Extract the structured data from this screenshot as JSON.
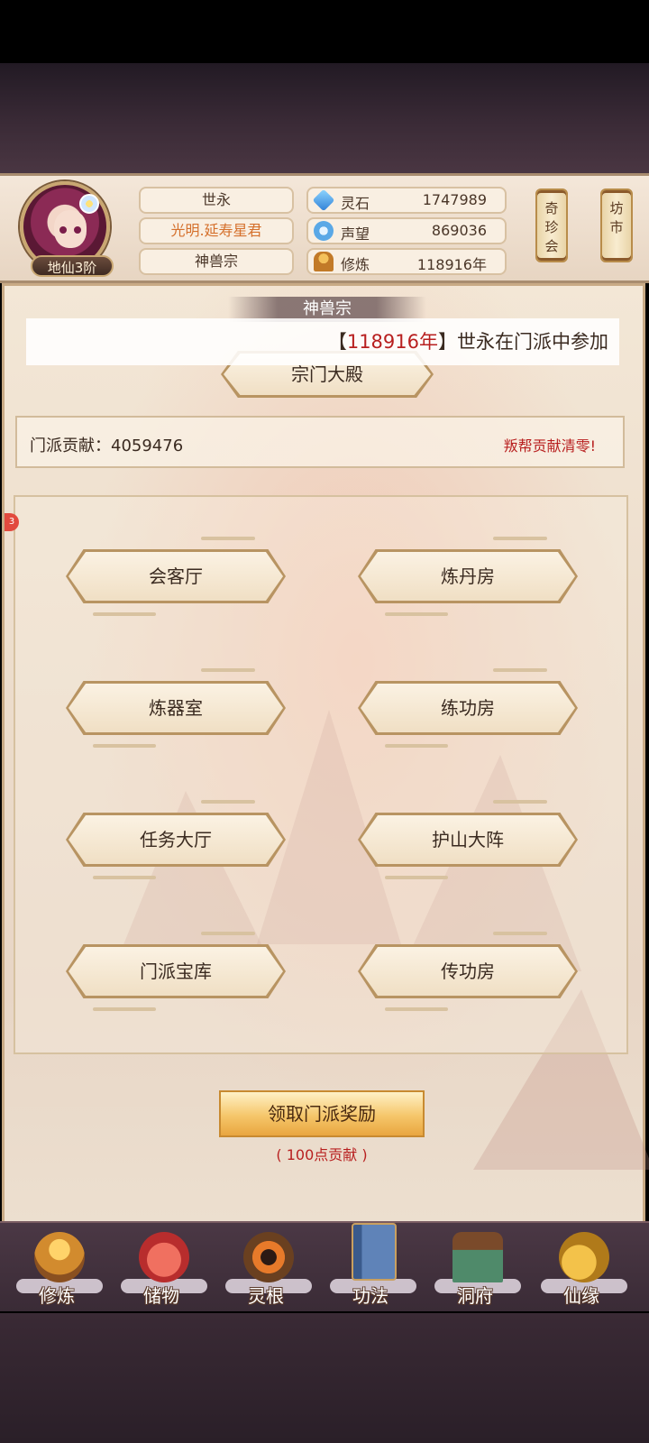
{
  "player": {
    "rank": "地仙3阶",
    "name": "世永",
    "title": "光明.延寿星君",
    "sect": "神兽宗"
  },
  "stats": [
    {
      "label": "灵石",
      "value": "1747989",
      "icon": "spirit-stone-icon"
    },
    {
      "label": "声望",
      "value": "869036",
      "icon": "reputation-icon"
    },
    {
      "label": "修炼",
      "value": "118916年",
      "icon": "cultivation-icon"
    }
  ],
  "side_buttons": {
    "treasure": "奇珍会",
    "market": "坊市"
  },
  "panel": {
    "sect_title": "神兽宗",
    "ticker": {
      "open": "【",
      "highlight": "118916年",
      "close": "】",
      "text": "世永在门派中参加"
    },
    "hall_button": "宗门大殿",
    "contribution_label": "门派贡献：",
    "contribution_value": "4059476",
    "contribution_warning": "叛帮贡献清零!",
    "badge_count": "3",
    "rooms": [
      "会客厅",
      "炼丹房",
      "炼器室",
      "练功房",
      "任务大厅",
      "护山大阵",
      "门派宝库",
      "传功房"
    ],
    "claim_button": "领取门派奖励",
    "claim_cost": "( 100点贡献 )"
  },
  "nav": [
    {
      "label": "修炼",
      "icon": "cultivate-icon"
    },
    {
      "label": "储物",
      "icon": "storage-bag-icon"
    },
    {
      "label": "灵根",
      "icon": "spirit-root-icon"
    },
    {
      "label": "功法",
      "icon": "technique-book-icon"
    },
    {
      "label": "洞府",
      "icon": "cave-house-icon"
    },
    {
      "label": "仙缘",
      "icon": "immortal-fate-icon"
    }
  ]
}
